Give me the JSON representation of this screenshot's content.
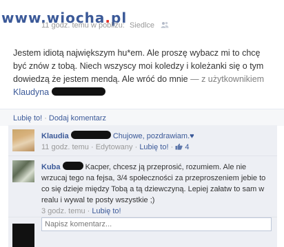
{
  "header": {
    "watermark_main": "www.wiocha",
    "watermark_dot": ".",
    "watermark_tld": "pl",
    "time_ago": "11 godz. temu w pobliżu:",
    "location": "Siedlce"
  },
  "post": {
    "text": "Jestem idiotą największym hu*em. Ale proszę wybacz mi to chcę być znów z tobą. Niech wszyscy moi koledzy i koleżanki się o tym dowiedzą że jestem mendą. Ale wróć do mnie",
    "with_label": "— z użytkownikiem",
    "tagged_name": "Klaudyna"
  },
  "actions": {
    "like_label": "Lubię to!",
    "comment_label": "Dodaj komentarz",
    "separator": "·"
  },
  "comments": [
    {
      "author": "Klaudia",
      "text": "Chujowe, pozdrawiam.♥",
      "time": "11 godz. temu",
      "edited": "Edytowany",
      "like_label": "Lubię to!",
      "likes": "4"
    },
    {
      "author": "Kuba",
      "text": "Kacper, chcesz ją przeprosić, rozumiem. Ale nie wrzucaj tego na fejsa, 3/4 społeczności za przeproszeniem jebie to co się dzieje między Tobą a tą dziewczyną. Lepiej załatw to sam w realu i wywal te posty wszystkie ;)",
      "time": "3 godz. temu",
      "like_label": "Lubię to!"
    }
  ],
  "new_comment": {
    "placeholder": "Napisz komentarz..."
  },
  "icons": {
    "privacy": "friends-icon",
    "like": "thumbs-up-icon"
  },
  "colors": {
    "link": "#3b5998",
    "muted": "#999999",
    "comments_bg": "#edeff4",
    "watermark_dot": "#e8281e"
  }
}
